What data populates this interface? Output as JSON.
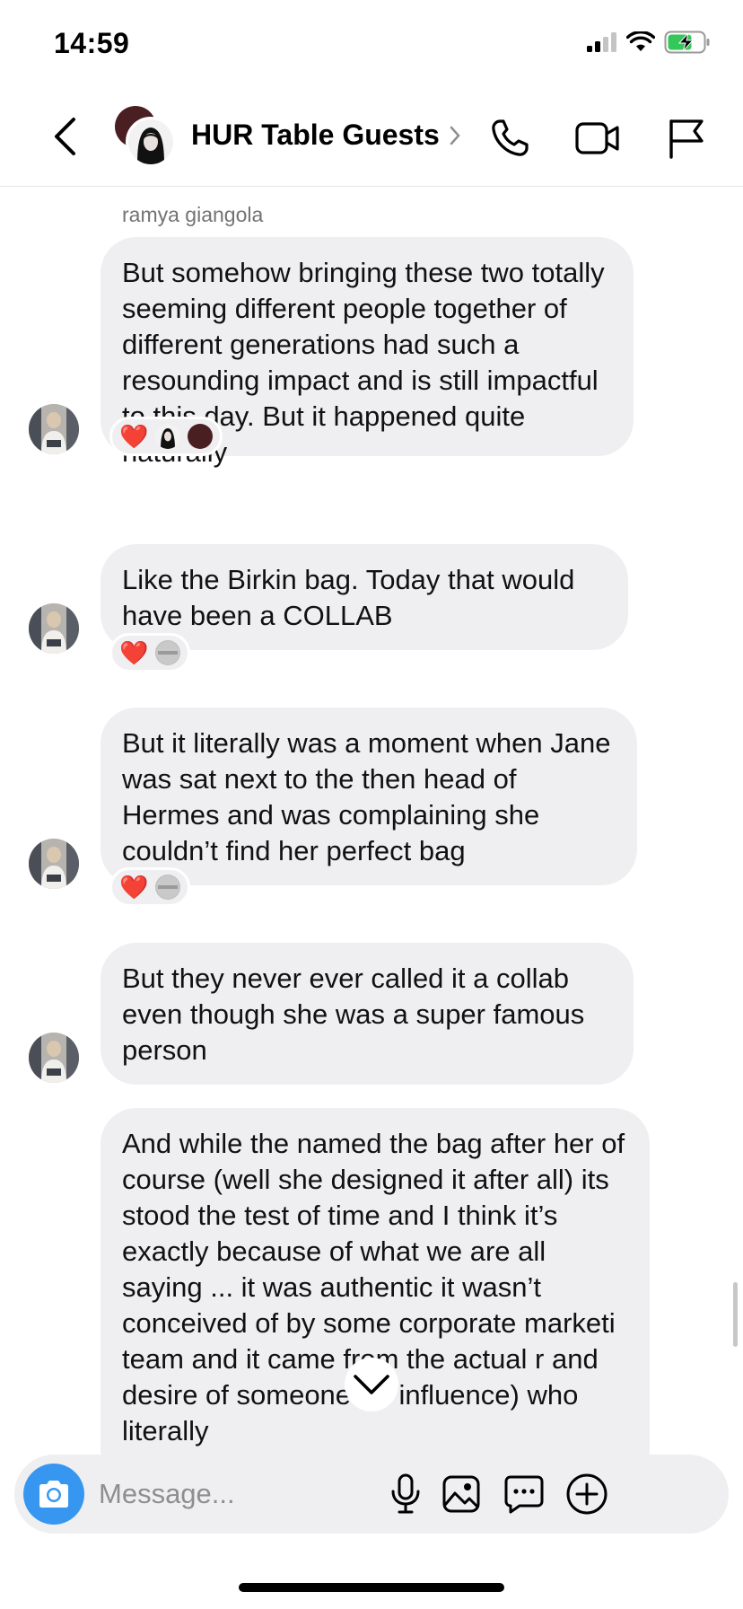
{
  "status": {
    "time": "14:59",
    "signal_icon": "signal-icon",
    "wifi_icon": "wifi-icon",
    "battery_icon": "battery-charging-icon"
  },
  "header": {
    "title": "HUR Table Guests",
    "back_icon": "chevron-left-icon",
    "actions": [
      "phone-icon",
      "video-camera-icon",
      "flag-icon"
    ]
  },
  "conversation": {
    "sender_name": "ramya giangola",
    "messages": [
      {
        "text": "But somehow bringing these two totally seeming different people together of different generations had such a resounding impact and is still impactful to this day. But it happened quite naturally",
        "reactions": [
          "❤️",
          "avatar-bw",
          "avatar-maroon"
        ]
      },
      {
        "text": "Like the Birkin bag. Today that would have been a COLLAB",
        "reactions": [
          "❤️",
          "avatar-grey"
        ]
      },
      {
        "text": "But it literally was a moment when Jane was sat next to the then head of Hermes and was complaining she couldn’t find her perfect bag",
        "reactions": [
          "❤️",
          "avatar-grey"
        ]
      },
      {
        "text": "But they never ever called it a collab even though she was a super famous person",
        "reactions": []
      },
      {
        "text": "And while the named the bag after her of course (well she designed it after all) its stood the test of time and I think it’s exactly because of what we are all saying ... it was authentic it wasn’t conceived of by some corporate marketi   team and it came from the actual r   and desire of someone (of influence) who literally",
        "reactions": []
      }
    ]
  },
  "composer": {
    "placeholder": "Message...",
    "icons": [
      "camera-icon",
      "microphone-icon",
      "image-icon",
      "sticker-icon",
      "plus-circle-icon"
    ]
  },
  "colors": {
    "accent": "#3797f0",
    "bubble": "#efeff1",
    "heart": "#e0112b"
  }
}
